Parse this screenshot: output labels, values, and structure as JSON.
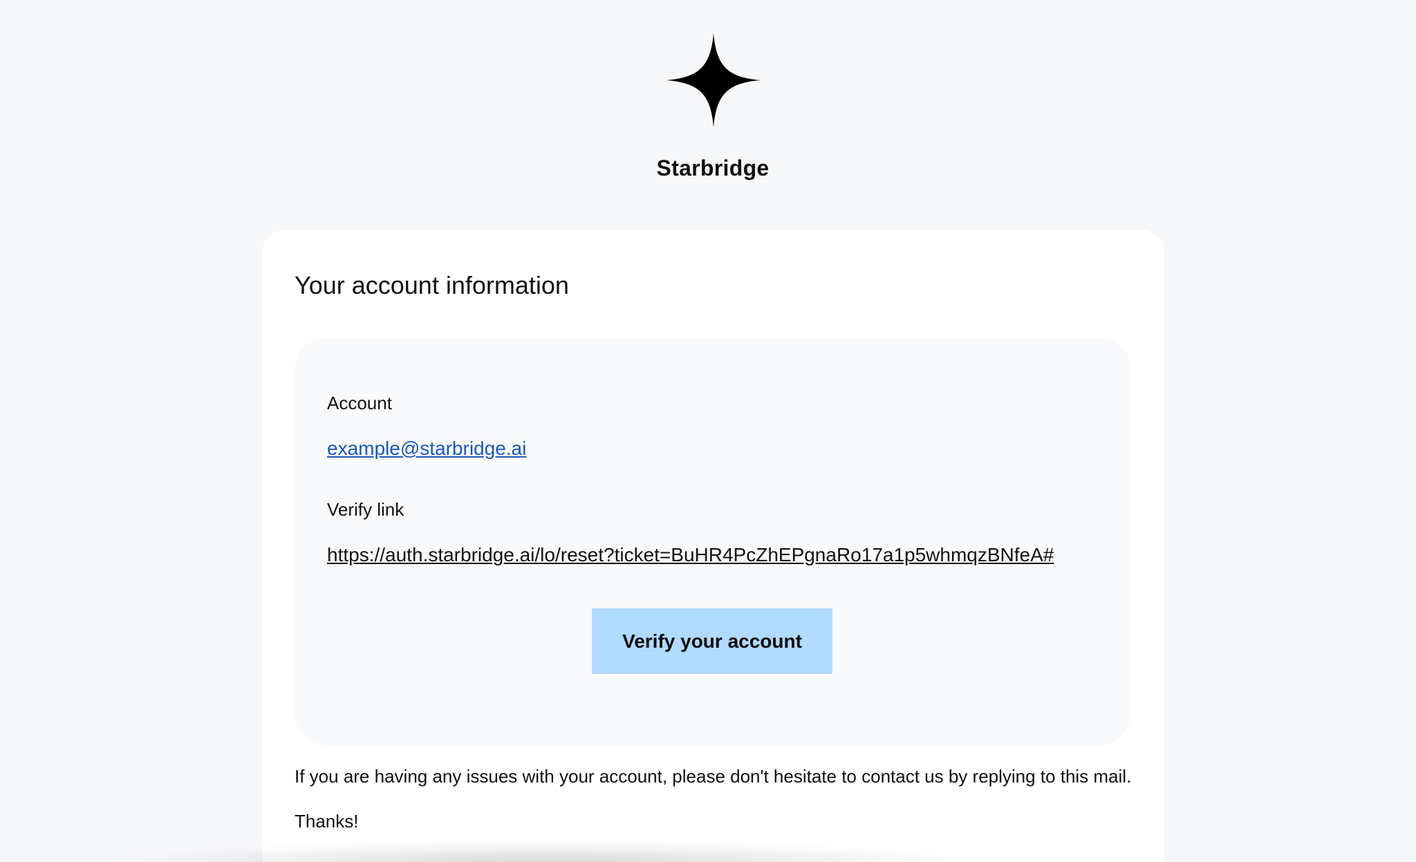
{
  "brand": {
    "name": "Starbridge",
    "logo_icon": "four-point-star-icon",
    "logo_color": "#000000"
  },
  "card": {
    "title": "Your account information",
    "account_label": "Account",
    "account_email": "example@starbridge.ai",
    "verify_label": "Verify link",
    "verify_url": "https://auth.starbridge.ai/lo/reset?ticket=BuHR4PcZhEPgnaRo17a1p5whmqzBNfeA#",
    "verify_button_label": "Verify your account",
    "issues_text": "If you are having any issues with your account, please don't hesitate to contact us by replying to this mail.",
    "thanks_text": "Thanks!"
  },
  "colors": {
    "page_background": "#f6f7f9",
    "card_background": "#ffffff",
    "info_box_background": "#f9fafc",
    "link_color": "#1a57c2",
    "button_color": "#b1daff"
  }
}
